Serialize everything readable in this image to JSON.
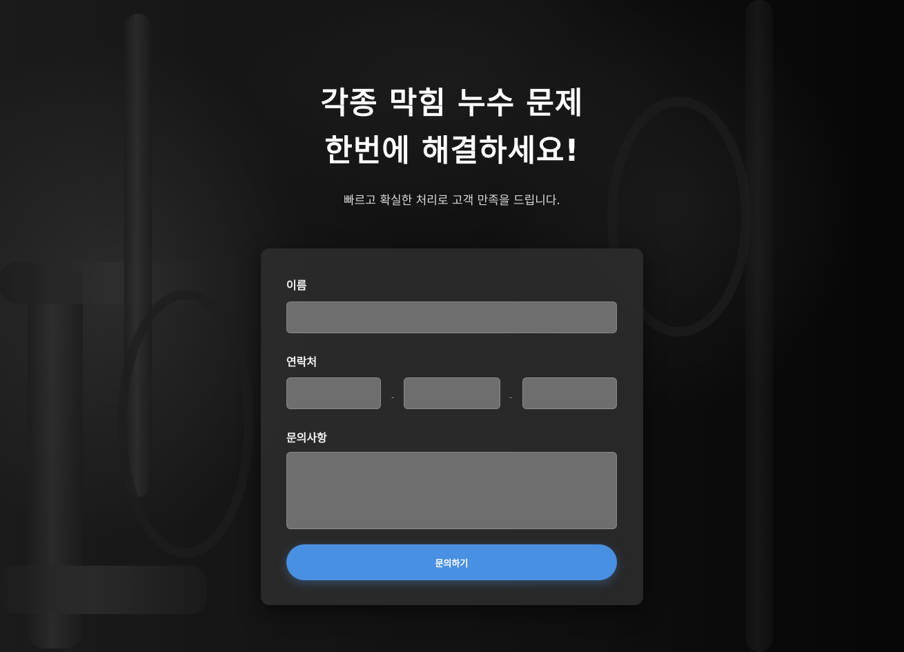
{
  "hero": {
    "headline_line1": "각종 막힘 누수 문제",
    "headline_line2": "한번에 해결하세요!",
    "subheadline": "빠르고 확실한 처리로 고객 만족을 드립니다."
  },
  "form": {
    "name_label": "이름",
    "name_value": "",
    "phone_label": "연락처",
    "phone_part1": "",
    "phone_part2": "",
    "phone_part3": "",
    "phone_separator": "-",
    "inquiry_label": "문의사항",
    "inquiry_value": "",
    "submit_label": "문의하기"
  },
  "colors": {
    "accent": "#4a90e2",
    "card_background": "#2e2e2e",
    "field_background": "#6e6e6e"
  }
}
